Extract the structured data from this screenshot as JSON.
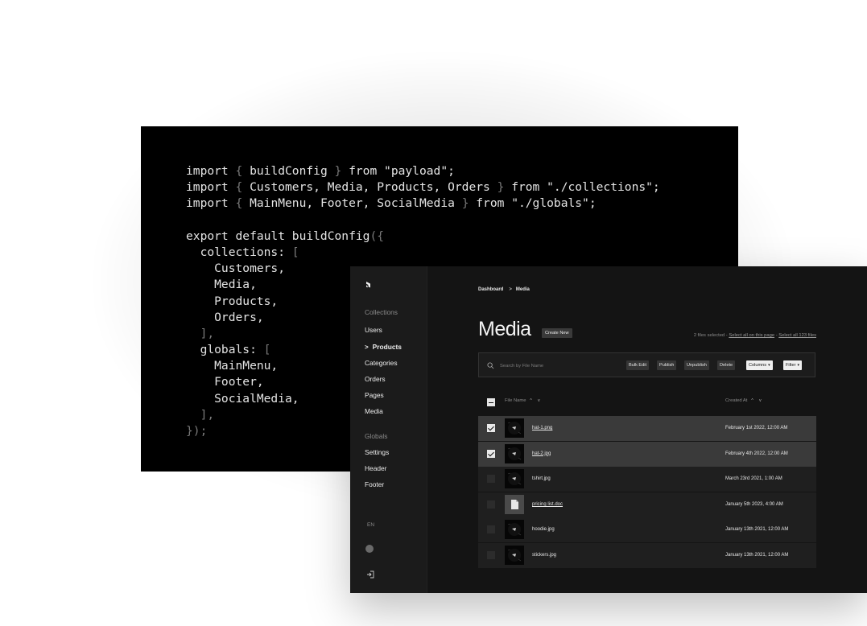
{
  "code": {
    "lines": [
      [
        {
          "t": "import ",
          "c": "s"
        },
        {
          "t": "{ ",
          "c": "p"
        },
        {
          "t": "buildConfig ",
          "c": "s"
        },
        {
          "t": "} ",
          "c": "p"
        },
        {
          "t": "from \"payload\";",
          "c": "s"
        }
      ],
      [
        {
          "t": "import ",
          "c": "s"
        },
        {
          "t": "{ ",
          "c": "p"
        },
        {
          "t": "Customers, Media, Products, Orders ",
          "c": "s"
        },
        {
          "t": "} ",
          "c": "p"
        },
        {
          "t": "from \"./collections\";",
          "c": "s"
        }
      ],
      [
        {
          "t": "import ",
          "c": "s"
        },
        {
          "t": "{ ",
          "c": "p"
        },
        {
          "t": "MainMenu, Footer, SocialMedia ",
          "c": "s"
        },
        {
          "t": "} ",
          "c": "p"
        },
        {
          "t": "from \"./globals\";",
          "c": "s"
        }
      ],
      [],
      [
        {
          "t": "export default buildConfig",
          "c": "s"
        },
        {
          "t": "({",
          "c": "p"
        }
      ],
      [
        {
          "t": "  collections: ",
          "c": "s"
        },
        {
          "t": "[",
          "c": "p"
        }
      ],
      [
        {
          "t": "    Customers,",
          "c": "s"
        }
      ],
      [
        {
          "t": "    Media,",
          "c": "s"
        }
      ],
      [
        {
          "t": "    Products,",
          "c": "s"
        }
      ],
      [
        {
          "t": "    Orders,",
          "c": "s"
        }
      ],
      [
        {
          "t": "  ],",
          "c": "p"
        }
      ],
      [
        {
          "t": "  globals: ",
          "c": "s"
        },
        {
          "t": "[",
          "c": "p"
        }
      ],
      [
        {
          "t": "    MainMenu,",
          "c": "s"
        }
      ],
      [
        {
          "t": "    Footer,",
          "c": "s"
        }
      ],
      [
        {
          "t": "    SocialMedia,",
          "c": "s"
        }
      ],
      [
        {
          "t": "  ],",
          "c": "p"
        }
      ],
      [
        {
          "t": "});",
          "c": "p"
        }
      ]
    ]
  },
  "nav": {
    "collections_heading": "Collections",
    "collections": [
      "Users",
      "Products",
      "Categories",
      "Orders",
      "Pages",
      "Media"
    ],
    "active_collection": "Products",
    "globals_heading": "Globals",
    "globals": [
      "Settings",
      "Header",
      "Footer"
    ],
    "language": "EN"
  },
  "breadcrumb": {
    "root": "Dashboard",
    "separator": ">",
    "current": "Media"
  },
  "page": {
    "title": "Media",
    "create_label": "Create New",
    "selected_text": "2 files selected",
    "dash": "-",
    "select_page_label": "Select all on this page",
    "select_all_label": "Select all 123 files"
  },
  "toolbar": {
    "search_placeholder": "Search by File Name",
    "bulk_edit": "Bulk Edit",
    "publish": "Publish",
    "unpublish": "Unpublish",
    "delete": "Delete",
    "columns": "Columns",
    "filter": "Filter"
  },
  "table": {
    "headers": {
      "file_name": "File Name",
      "created_at": "Created At",
      "sort": "^ v"
    },
    "rows": [
      {
        "name": "hat-1.png",
        "date": "February 1st 2022, 12:00 AM",
        "selected": true,
        "linked": true,
        "thumb": "dark"
      },
      {
        "name": "hat-2.jpg",
        "date": "February 4th 2022, 12:00 AM",
        "selected": true,
        "linked": true,
        "thumb": "dark"
      },
      {
        "name": "tshirt.jpg",
        "date": "March 23rd 2021, 1:00 AM",
        "selected": false,
        "linked": false,
        "thumb": "dark"
      },
      {
        "name": "pricing list.doc",
        "date": "January 5th 2023, 4:00 AM",
        "selected": false,
        "linked": true,
        "thumb": "doc"
      },
      {
        "name": "hoodie.jpg",
        "date": "January 13th 2021, 12:00 AM",
        "selected": false,
        "linked": false,
        "thumb": "dark"
      },
      {
        "name": "stickers.jpg",
        "date": "January 13th 2021, 12:00 AM",
        "selected": false,
        "linked": false,
        "thumb": "dark"
      }
    ]
  },
  "colors": {
    "background": "#ffffff",
    "code_bg": "#000000",
    "admin_bg": "#141414",
    "selected_row": "#3a3a3a"
  }
}
